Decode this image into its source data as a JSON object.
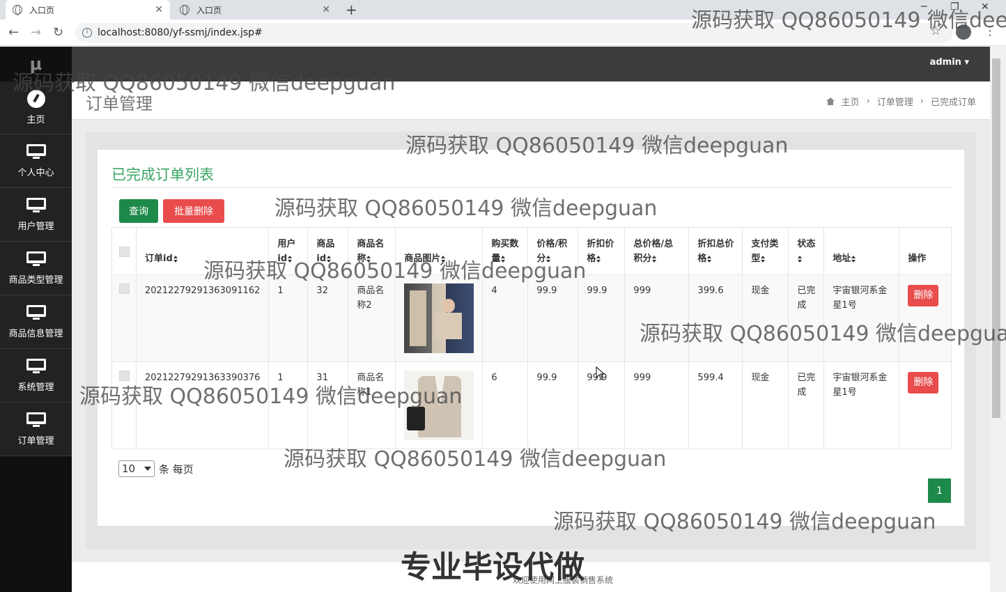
{
  "browser": {
    "tabs": [
      {
        "label": "入口页"
      },
      {
        "label": "入口页"
      }
    ],
    "url": "localhost:8080/yf-ssmj/index.jsp#"
  },
  "sidebar": {
    "logo": "μ",
    "items": [
      {
        "label": "主页",
        "icon": "dashboard-icon"
      },
      {
        "label": "个人中心",
        "icon": "monitor-icon"
      },
      {
        "label": "用户管理",
        "icon": "monitor-icon"
      },
      {
        "label": "商品类型管理",
        "icon": "monitor-icon"
      },
      {
        "label": "商品信息管理",
        "icon": "monitor-icon"
      },
      {
        "label": "系统管理",
        "icon": "monitor-icon"
      },
      {
        "label": "订单管理",
        "icon": "monitor-icon"
      }
    ]
  },
  "header": {
    "user": "admin"
  },
  "page": {
    "title": "订单管理",
    "breadcrumb": [
      "主页",
      "订单管理",
      "已完成订单"
    ]
  },
  "panel": {
    "title": "已完成订单列表",
    "query_label": "查询",
    "batch_delete_label": "批量删除"
  },
  "table": {
    "headers": [
      "订单id",
      "用户id",
      "商品id",
      "商品名称",
      "商品图片",
      "购买数量",
      "价格/积分",
      "折扣价格",
      "总价格/总积分",
      "折扣总价格",
      "支付类型",
      "状态",
      "地址",
      "操作"
    ],
    "rows": [
      {
        "order_id": "20212279291363091162",
        "user_id": "1",
        "product_id": "32",
        "product_name": "商品名称2",
        "qty": "4",
        "price": "99.9",
        "discount_price": "99.9",
        "total": "999",
        "discount_total": "399.6",
        "pay_type": "现金",
        "status": "已完成",
        "address": "宇宙银河系金星1号",
        "action": "删除"
      },
      {
        "order_id": "20212279291363390376",
        "user_id": "1",
        "product_id": "31",
        "product_name": "商品名称1",
        "qty": "6",
        "price": "99.9",
        "discount_price": "99.9",
        "total": "999",
        "discount_total": "599.4",
        "pay_type": "现金",
        "status": "已完成",
        "address": "宇宙银河系金星1号",
        "action": "删除"
      }
    ]
  },
  "pagination": {
    "page_size": "10",
    "page_size_suffix": "条 每页",
    "current_page": "1"
  },
  "footer": {
    "text": "欢迎使用网上服装销售系统"
  },
  "watermark": {
    "text": "源码获取 QQ86050149 微信deepguan",
    "big": "专业毕设代做"
  }
}
